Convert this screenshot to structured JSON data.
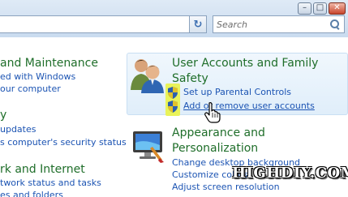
{
  "window": {
    "minimize_glyph": "–",
    "maximize_glyph": "□",
    "close_glyph": "✕"
  },
  "toolbar": {
    "refresh_glyph": "↻",
    "search_placeholder": "Search"
  },
  "left_column": {
    "system_heading": "and Maintenance",
    "system_links": [
      "ed with Windows",
      "our computer"
    ],
    "security_heading": "y",
    "security_links": [
      "updates",
      "s computer's security status"
    ],
    "network_heading": "rk and Internet",
    "network_links": [
      "twork status and tasks",
      "es and folders"
    ]
  },
  "user_accounts": {
    "heading_line1": "User Accounts and Family",
    "heading_line2": "Safety",
    "links": [
      "Set up Parental Controls",
      "Add or remove user accounts"
    ],
    "icon": "users-icon"
  },
  "appearance": {
    "heading_line1": "Appearance and",
    "heading_line2": "Personalization",
    "links": [
      "Change desktop background",
      "Customize colors",
      "Adjust screen resolution"
    ],
    "icon": "display-paint-icon"
  },
  "watermark": "HIGHDIY.COM",
  "colors": {
    "heading_green": "#1f6e2a",
    "link_blue": "#1c54b3",
    "highlight_yellow": "#e9f35a"
  }
}
